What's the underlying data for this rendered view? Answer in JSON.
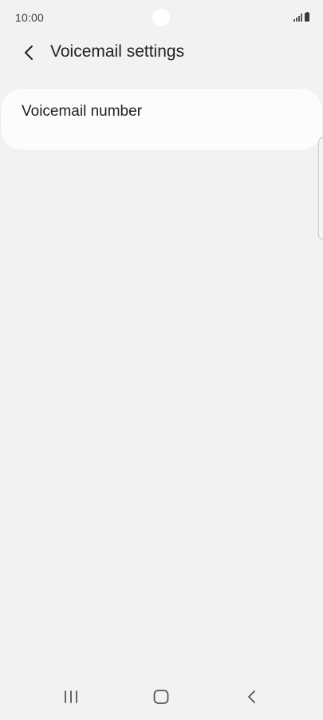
{
  "status_bar": {
    "time": "10:00",
    "icons": [
      "signal-icon",
      "battery-icon"
    ]
  },
  "header": {
    "back_icon": "chevron-left-icon",
    "title": "Voicemail settings"
  },
  "settings": {
    "items": [
      {
        "label": "Voicemail number"
      }
    ]
  },
  "nav_bar": {
    "buttons": [
      "recent-apps-icon",
      "home-icon",
      "back-icon"
    ]
  },
  "colors": {
    "background": "#f2f2f2",
    "card": "#fcfcfc",
    "text_primary": "#1f1f1f"
  }
}
